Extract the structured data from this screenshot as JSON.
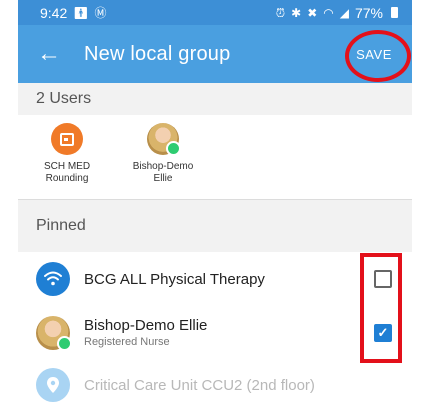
{
  "status_bar": {
    "time": "9:42",
    "battery": "77%",
    "left_icons": [
      "person-icon",
      "at-icon"
    ],
    "right_icons": [
      "alarm-icon",
      "bluetooth-icon",
      "mute-icon",
      "wifi-icon",
      "signal-icon",
      "battery-icon"
    ]
  },
  "app_bar": {
    "title": "New local group",
    "save_label": "SAVE",
    "background": "#4a9fe0"
  },
  "users_section": {
    "header": "2 Users",
    "users": [
      {
        "name_line1": "SCH MED",
        "name_line2": "Rounding",
        "avatar": "calendar-icon",
        "avatar_color": "#f07a28"
      },
      {
        "name_line1": "Bishop-Demo",
        "name_line2": "Ellie",
        "avatar": "photo",
        "online": true
      }
    ]
  },
  "pinned_section": {
    "header": "Pinned",
    "items": [
      {
        "title": "BCG ALL Physical Therapy",
        "subtitle": "",
        "icon": "wifi-icon",
        "checked": false
      },
      {
        "title": "Bishop-Demo Ellie",
        "subtitle": "Registered Nurse",
        "icon": "photo",
        "checked": true
      },
      {
        "title": "Critical Care Unit CCU2 (2nd floor)",
        "subtitle": "",
        "icon": "location-pin-icon",
        "checked": null
      }
    ]
  },
  "colors": {
    "accent": "#1f7fd4",
    "highlight_red": "#e3101a",
    "online_green": "#2ecc71"
  }
}
